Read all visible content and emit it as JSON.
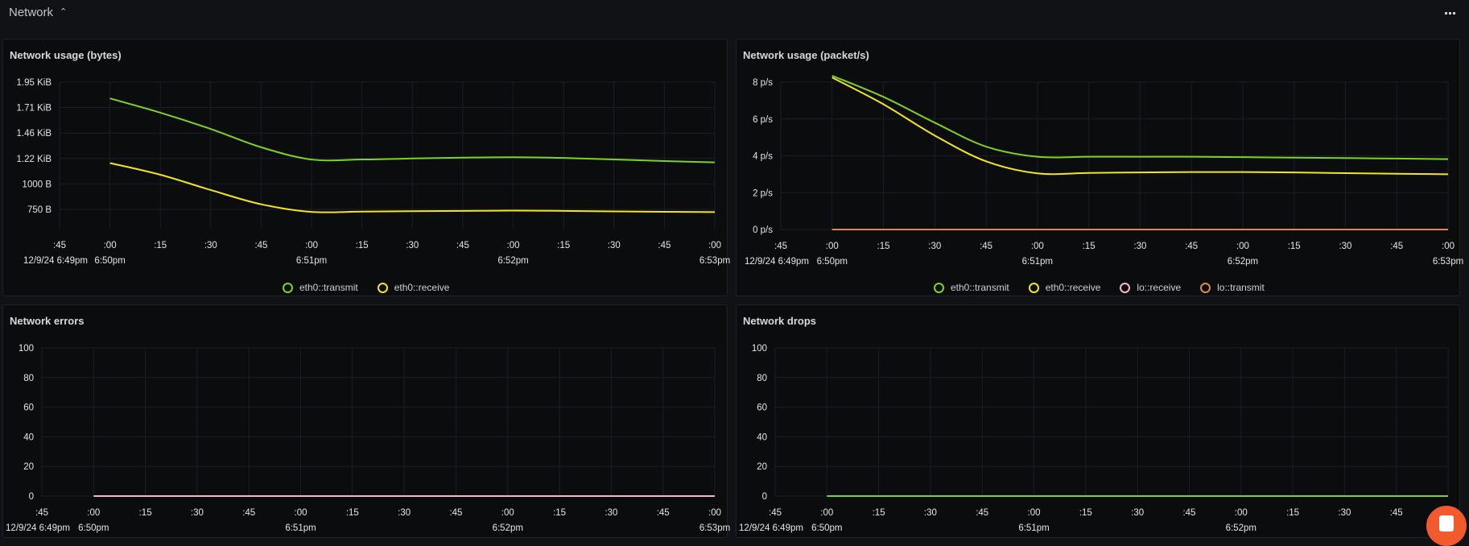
{
  "section": {
    "title": "Network",
    "collapse_icon": "chevron-up-icon",
    "more_icon": "more-horizontal-icon"
  },
  "colors": {
    "eth0_transmit": "#7ed321",
    "eth0_receive": "#f5e617",
    "lo_receive": "#f4b8c4",
    "lo_transmit": "#d98b4e",
    "grid": "#1c1e22",
    "chat_button": "#f05a2c"
  },
  "x_axis": {
    "ticks": [
      ":45",
      ":00",
      ":15",
      ":30",
      ":45",
      ":00",
      ":15",
      ":30",
      ":45",
      ":00",
      ":15",
      ":30",
      ":45",
      ":00"
    ],
    "tick_seconds": [
      -15,
      0,
      15,
      30,
      45,
      60,
      75,
      90,
      105,
      120,
      135,
      150,
      165,
      180
    ],
    "sublabels": [
      {
        "at_index": 0,
        "text": "12/9/24 6:49pm"
      },
      {
        "at_index": 1,
        "text": "6:50pm"
      },
      {
        "at_index": 5,
        "text": "6:51pm"
      },
      {
        "at_index": 9,
        "text": "6:52pm"
      },
      {
        "at_index": 13,
        "text": "6:53pm"
      }
    ],
    "range_seconds": [
      -15,
      180
    ]
  },
  "chat_button": {
    "icon": "chat-icon"
  },
  "chart_data": [
    {
      "id": "bytes",
      "type": "line",
      "title": "Network usage (bytes)",
      "xlabel": "",
      "ylabel": "",
      "x_unit": "seconds since 6:50pm",
      "y_ticks": [
        {
          "value": 750,
          "label": "750 B"
        },
        {
          "value": 1000,
          "label": "1000 B"
        },
        {
          "value": 1250,
          "label": "1.22 KiB"
        },
        {
          "value": 1500,
          "label": "1.46 KiB"
        },
        {
          "value": 1750,
          "label": "1.71 KiB"
        },
        {
          "value": 2000,
          "label": "1.95 KiB"
        }
      ],
      "ylim": [
        560,
        2000
      ],
      "grid": true,
      "legend": "bottom-center",
      "series": [
        {
          "name": "eth0::transmit",
          "color_key": "eth0_transmit",
          "x": [
            0,
            15,
            30,
            45,
            60,
            75,
            90,
            105,
            120,
            135,
            150,
            165,
            180
          ],
          "y": [
            1840,
            1700,
            1540,
            1360,
            1240,
            1240,
            1250,
            1258,
            1262,
            1255,
            1240,
            1225,
            1212
          ]
        },
        {
          "name": "eth0::receive",
          "color_key": "eth0_receive",
          "x": [
            0,
            15,
            30,
            45,
            60,
            75,
            90,
            105,
            120,
            135,
            150,
            165,
            180
          ],
          "y": [
            1205,
            1090,
            940,
            800,
            725,
            728,
            732,
            735,
            738,
            735,
            730,
            726,
            723
          ]
        }
      ]
    },
    {
      "id": "packets",
      "type": "line",
      "title": "Network usage (packet/s)",
      "xlabel": "",
      "ylabel": "",
      "x_unit": "seconds since 6:50pm",
      "y_ticks": [
        {
          "value": 0,
          "label": "0 p/s"
        },
        {
          "value": 2,
          "label": "2 p/s"
        },
        {
          "value": 4,
          "label": "4 p/s"
        },
        {
          "value": 6,
          "label": "6 p/s"
        },
        {
          "value": 8,
          "label": "8 p/s"
        }
      ],
      "ylim": [
        0,
        9.2
      ],
      "grid": true,
      "legend": "bottom-center",
      "series": [
        {
          "name": "eth0::transmit",
          "color_key": "eth0_transmit",
          "x": [
            0,
            15,
            30,
            45,
            60,
            75,
            90,
            105,
            120,
            135,
            150,
            165,
            180
          ],
          "y": [
            8.35,
            7.2,
            5.8,
            4.5,
            3.95,
            3.95,
            3.95,
            3.95,
            3.93,
            3.9,
            3.88,
            3.85,
            3.82
          ]
        },
        {
          "name": "eth0::receive",
          "color_key": "eth0_receive",
          "x": [
            0,
            15,
            30,
            45,
            60,
            75,
            90,
            105,
            120,
            135,
            150,
            165,
            180
          ],
          "y": [
            8.25,
            6.8,
            5.1,
            3.7,
            3.05,
            3.07,
            3.1,
            3.12,
            3.12,
            3.1,
            3.06,
            3.03,
            3.0
          ]
        },
        {
          "name": "lo::receive",
          "color_key": "lo_receive",
          "x": [
            0,
            180
          ],
          "y": [
            0,
            0
          ]
        },
        {
          "name": "lo::transmit",
          "color_key": "lo_transmit",
          "x": [
            0,
            180
          ],
          "y": [
            0,
            0
          ]
        }
      ]
    },
    {
      "id": "errors",
      "type": "line",
      "title": "Network errors",
      "xlabel": "",
      "ylabel": "",
      "x_unit": "seconds since 6:50pm",
      "y_ticks": [
        {
          "value": 0,
          "label": "0"
        },
        {
          "value": 20,
          "label": "20"
        },
        {
          "value": 40,
          "label": "40"
        },
        {
          "value": 60,
          "label": "60"
        },
        {
          "value": 80,
          "label": "80"
        },
        {
          "value": 100,
          "label": "100"
        }
      ],
      "ylim": [
        0,
        100
      ],
      "grid": true,
      "legend": "none",
      "series": [
        {
          "name": "lo::receive",
          "color_key": "lo_receive",
          "x": [
            0,
            180
          ],
          "y": [
            0,
            0
          ]
        }
      ]
    },
    {
      "id": "drops",
      "type": "line",
      "title": "Network drops",
      "xlabel": "",
      "ylabel": "",
      "x_unit": "seconds since 6:50pm",
      "y_ticks": [
        {
          "value": 0,
          "label": "0"
        },
        {
          "value": 20,
          "label": "20"
        },
        {
          "value": 40,
          "label": "40"
        },
        {
          "value": 60,
          "label": "60"
        },
        {
          "value": 80,
          "label": "80"
        },
        {
          "value": 100,
          "label": "100"
        }
      ],
      "ylim": [
        0,
        100
      ],
      "grid": true,
      "legend": "none",
      "series": [
        {
          "name": "eth0::transmit",
          "color_key": "eth0_transmit",
          "x": [
            0,
            180
          ],
          "y": [
            0,
            0
          ]
        }
      ]
    }
  ]
}
